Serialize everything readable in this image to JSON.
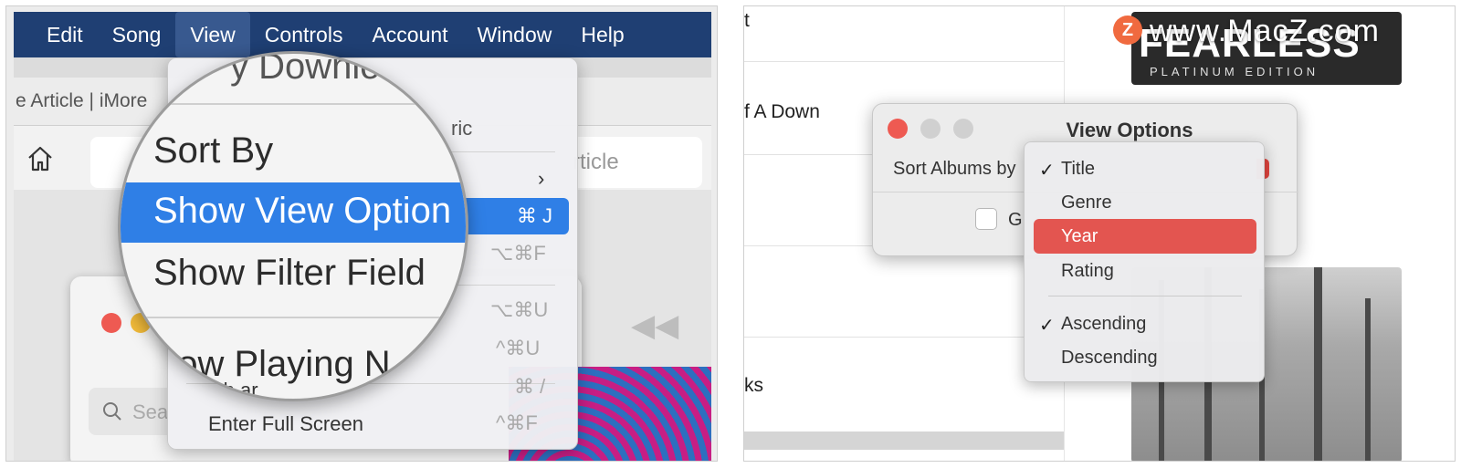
{
  "left": {
    "menubar": [
      "Edit",
      "Song",
      "View",
      "Controls",
      "Account",
      "Window",
      "Help"
    ],
    "active_menu": "View",
    "tab_title": "e Article | iMore",
    "address_suffix": "rticle",
    "search_placeholder": "Sea",
    "dropdown": {
      "partial_top": "y Downlo",
      "partial_mid": "ric",
      "enter_full_screen": "Enter Full Screen",
      "shortcuts": [
        "⌘ J",
        "⌥⌘F",
        "⌥⌘U",
        "^⌘U",
        "⌘ /",
        "^⌘F"
      ],
      "submenu_arrow": "›"
    },
    "magnifier": {
      "top_partial": "y Downlo",
      "sort_by": "Sort By",
      "show_view_options": "Show View Option",
      "show_filter_field": "Show Filter Field",
      "show_playing": "how Playing N",
      "partial_bottom": "Sh     ar"
    }
  },
  "right": {
    "list_texts": [
      "t",
      "f A Down",
      "ks"
    ],
    "watermark": "www.MacZ.com",
    "watermark_logo": "Z",
    "album_top_title": "FEARLESS",
    "album_top_sub": "PLATINUM EDITION",
    "es_text": "ES",
    "view_options": {
      "title": "View Options",
      "sort_label": "Sort Albums by",
      "checkbox_label": "G"
    },
    "sort_menu": {
      "items": [
        "Title",
        "Genre",
        "Year",
        "Rating"
      ],
      "order": [
        "Ascending",
        "Descending"
      ],
      "checked_item": "Title",
      "checked_order": "Ascending",
      "highlighted": "Year",
      "check_glyph": "✓"
    }
  },
  "colors": {
    "menubar": "#1f3f73",
    "highlight_blue": "#2f7fe6",
    "highlight_red": "#e35550",
    "close_red": "#ee5a52"
  }
}
